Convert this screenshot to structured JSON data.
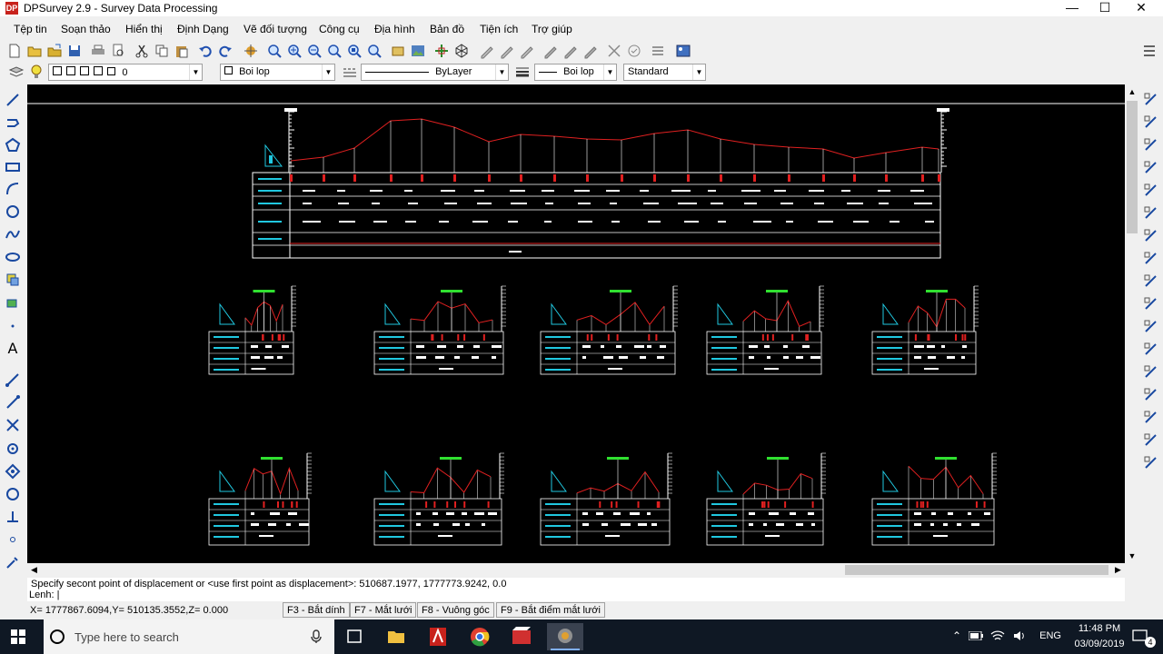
{
  "window": {
    "app_icon_text": "DP",
    "title": "DPSurvey 2.9 - Survey Data Processing",
    "minimize": "—",
    "maximize": "☐",
    "close": "✕"
  },
  "menu": [
    "Tệp tin",
    "Soạn thảo",
    "Hiển thị",
    "Định Dạng",
    "Vẽ đối tượng",
    "Công cụ",
    "Địa hình",
    "Bản đồ",
    "Tiện ích",
    "Trợ giúp"
  ],
  "toolbar2": {
    "layer_value": "0",
    "color_value": "Boi lop",
    "linetype_value": "ByLayer",
    "lineweight_value": "Boi lop",
    "style_value": "Standard"
  },
  "command": {
    "history": "Specify secont point of displacement or <use first point as displacement>:   510687.1977, 1777773.9242, 0.0",
    "prompt": "Lenh:  |"
  },
  "status": {
    "coords": "X= 1777867.6094,Y= 510135.3552,Z= 0.000",
    "f3": "F3 - Bắt dính",
    "f7": "F7 - Mắt lưới",
    "f8": "F8 - Vuông góc",
    "f9": "F9 - Bắt điểm mắt lưới"
  },
  "taskbar": {
    "search_placeholder": "Type here to search",
    "language": "ENG",
    "time": "11:48 PM",
    "date": "03/09/2019",
    "notification_count": "4"
  },
  "colors": {
    "canvas": "#000000",
    "profile_line": "#e02020",
    "grid_white": "#ffffff",
    "label_cyan": "#20c8e0",
    "label_green": "#30e030",
    "station_red": "#e02020",
    "taskbar": "#0f1824"
  },
  "icons": {
    "left_tools": [
      "line-icon",
      "polyline-icon",
      "polygon-icon",
      "rectangle-icon",
      "arc-icon",
      "circle-icon",
      "spline-icon",
      "ellipse-icon",
      "insert-block-icon",
      "make-block-icon",
      "point-icon",
      "text-icon",
      "measure-icon",
      "dimension-icon",
      "trim-icon",
      "extend-icon",
      "snap-icon",
      "rotate-icon",
      "perpendicular-icon",
      "node-icon",
      "settings-icon"
    ],
    "right_tools": [
      "dim-linear-icon",
      "dim-aligned-icon",
      "dim-ordinate-icon",
      "dim-radius-icon",
      "dim-diameter-icon",
      "dim-angular-icon",
      "baseline-icon",
      "continue-icon",
      "edit-icon",
      "copy-icon",
      "mirror-icon",
      "move-icon",
      "rotate-icon",
      "scale-icon",
      "stretch-icon",
      "break-icon",
      "explode-icon"
    ]
  }
}
